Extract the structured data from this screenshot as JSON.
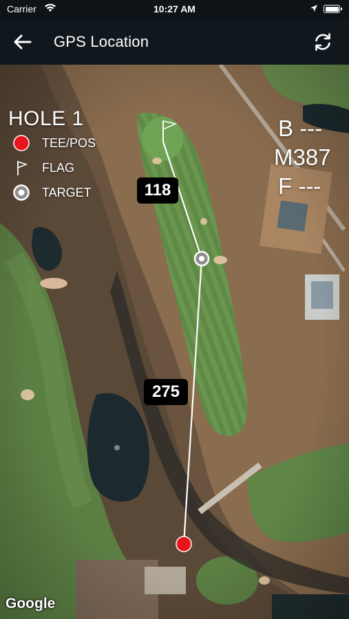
{
  "status_bar": {
    "carrier": "Carrier",
    "time": "10:27 AM",
    "wifi_icon": "wifi-icon",
    "location_icon": "location-arrow-icon",
    "battery_icon": "battery-icon"
  },
  "nav": {
    "back_icon": "back-arrow-icon",
    "title": "GPS Location",
    "refresh_icon": "refresh-icon"
  },
  "legend": {
    "hole": "HOLE 1",
    "items": [
      {
        "label": "TEE/POS",
        "icon": "tee-position-dot-icon",
        "color": "#e8141c"
      },
      {
        "label": "FLAG",
        "icon": "flag-icon"
      },
      {
        "label": "TARGET",
        "icon": "target-icon"
      }
    ]
  },
  "distances": {
    "back": "B ---",
    "middle": "M387",
    "front": "F ---"
  },
  "badges": {
    "to_flag": "118",
    "to_target": "275"
  },
  "attribution": "Google",
  "colors": {
    "tee_marker": "#e8141c",
    "line": "#ffffff",
    "nav_background": "#11181d"
  }
}
